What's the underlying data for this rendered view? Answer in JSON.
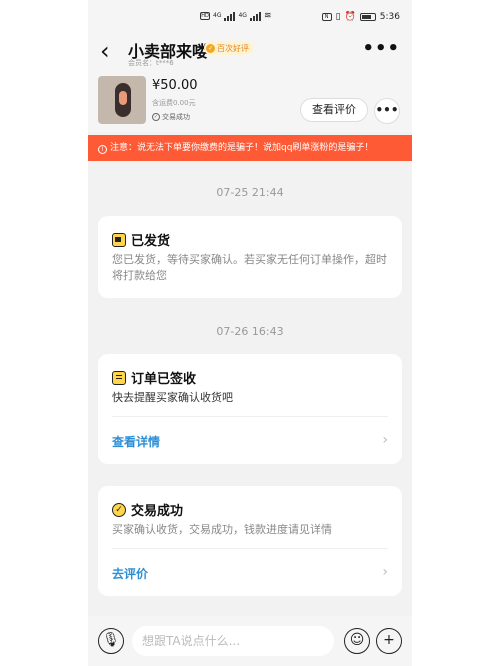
{
  "statusbar": {
    "mini_label_1": "4G",
    "mini_label_2": "4G",
    "nfc_icon": "N",
    "time": "5:36"
  },
  "header": {
    "title": "小卖部来喽",
    "badge": "百次好评",
    "badge_icon": "good-review-badge-icon",
    "subtitle": "会员名：t***6",
    "more": "•••"
  },
  "product": {
    "price": "¥50.00",
    "shipping": "含运费0.00元",
    "status": "交易成功",
    "review_button": "查看评价",
    "more": "•••"
  },
  "warning": {
    "text": "注意：说无法下单要你缴费的是骗子！说加qq刷单涨粉的是骗子！",
    "color": "#ff5a36"
  },
  "messages": [
    {
      "timestamp": "07-25 21:44",
      "title": "已发货",
      "icon": "truck-icon",
      "body": "您已发货，等待买家确认。若买家无任何订单操作，超时将打款给您"
    },
    {
      "timestamp": "07-26 16:43",
      "title": "订单已签收",
      "icon": "document-icon",
      "body": "快去提醒买家确认收货吧",
      "link": "查看详情"
    },
    {
      "title": "交易成功",
      "icon": "check-circle-icon",
      "body": "买家确认收货，交易成功，钱款进度请见详情",
      "link": "去评价"
    }
  ],
  "composer": {
    "placeholder": "想跟TA说点什么...",
    "chev": "›"
  },
  "colors": {
    "link": "#2d8fd5",
    "accent": "#ffd54a"
  }
}
